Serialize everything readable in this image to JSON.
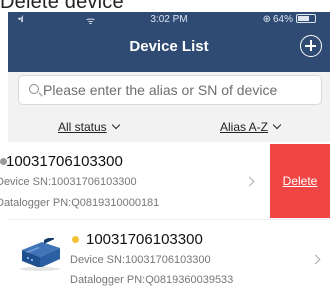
{
  "caption": "Delete device",
  "status_bar": {
    "signal": "•ıl",
    "wifi": "ᯤ",
    "time": "3:02 PM",
    "battery_icon": "⊕",
    "battery": "64%"
  },
  "header": {
    "title": "Device List"
  },
  "search": {
    "placeholder": "Please enter the alias or SN of device",
    "value": ""
  },
  "filters": {
    "status_label": "All status",
    "sort_label": "Alias A-Z"
  },
  "devices": [
    {
      "name": "10031706103300",
      "sn": "Device SN:10031706103300",
      "pn": "Datalogger PN:Q0819310000181",
      "status_color": "#9a9a9a",
      "action": "Delete"
    },
    {
      "name": "10031706103300",
      "sn": "Device SN:10031706103300",
      "pn": "Datalogger PN:Q0819360039533",
      "status_color": "#f2c230"
    }
  ],
  "colors": {
    "header": "#2f4b73",
    "delete": "#f04545",
    "background": "#f2f2f2"
  }
}
